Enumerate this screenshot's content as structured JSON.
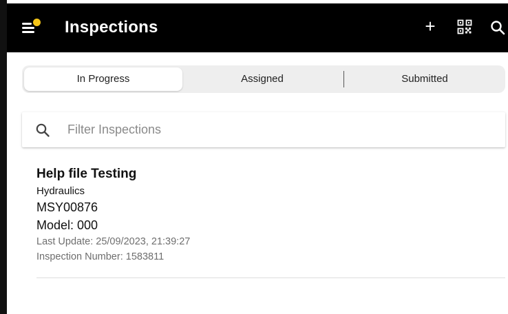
{
  "appbar": {
    "title": "Inspections",
    "add_label": "+",
    "notification_dot_color": "#f5c518",
    "icons": [
      "menu-icon",
      "plus-icon",
      "qr-code-icon",
      "search-icon"
    ]
  },
  "tabs": [
    {
      "label": "In Progress",
      "active": true
    },
    {
      "label": "Assigned",
      "active": false
    },
    {
      "label": "Submitted",
      "active": false
    }
  ],
  "filter": {
    "placeholder": "Filter Inspections",
    "value": ""
  },
  "inspections": [
    {
      "title": "Help file Testing",
      "category": "Hydraulics",
      "serial": "MSY00876",
      "model": "Model: 000",
      "last_update": "Last Update: 25/09/2023, 21:39:27",
      "inspection_number": "Inspection Number: 1583811"
    }
  ]
}
